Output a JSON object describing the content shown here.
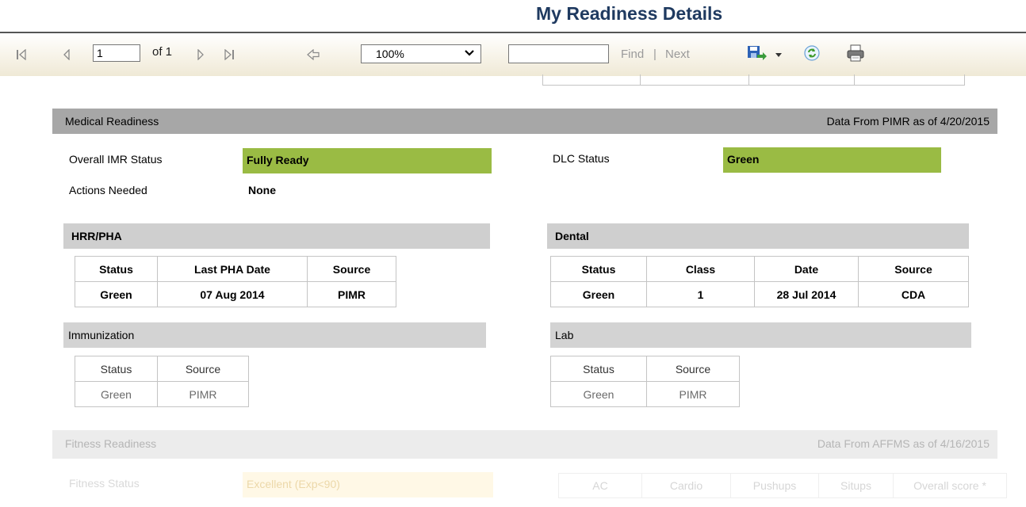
{
  "header": {
    "title": "My Readiness Details"
  },
  "toolbar": {
    "page_value": "1",
    "page_of": "of 1",
    "zoom": "100%",
    "find_value": "",
    "find": "Find",
    "separator": "|",
    "next": "Next"
  },
  "medical": {
    "title": "Medical Readiness",
    "source": "Data From PIMR as of 4/20/2015",
    "overall_label": "Overall IMR Status",
    "overall_value": "Fully Ready",
    "dlc_label": "DLC Status",
    "dlc_value": "Green",
    "actions_label": "Actions Needed",
    "actions_value": "None",
    "status_color": "#9abb44",
    "hrr": {
      "title": "HRR/PHA",
      "headers": [
        "Status",
        "Last PHA Date",
        "Source"
      ],
      "row": [
        "Green",
        "07 Aug 2014",
        "PIMR"
      ]
    },
    "dental": {
      "title": "Dental",
      "headers": [
        "Status",
        "Class",
        "Date",
        "Source"
      ],
      "row": [
        "Green",
        "1",
        "28 Jul 2014",
        "CDA"
      ]
    },
    "immunization": {
      "title": "Immunization",
      "headers": [
        "Status",
        "Source"
      ],
      "row": [
        "Green",
        "PIMR"
      ]
    },
    "lab": {
      "title": "Lab",
      "headers": [
        "Status",
        "Source"
      ],
      "row": [
        "Green",
        "PIMR"
      ]
    }
  },
  "fitness": {
    "title": "Fitness Readiness",
    "source": "Data From AFFMS as of 4/16/2015",
    "status_label": "Fitness Status",
    "status_value": "Excellent (Exp<90)",
    "headers": [
      "AC",
      "Cardio",
      "Pushups",
      "Situps",
      "Overall score *"
    ]
  }
}
